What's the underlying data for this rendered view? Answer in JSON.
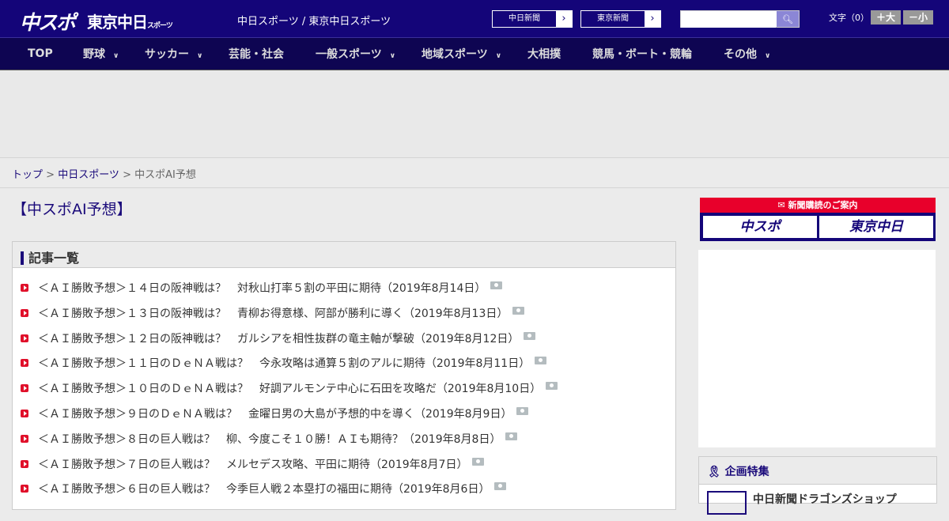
{
  "header": {
    "logo_main": "中スポ",
    "logo_tokyo": "東京中日",
    "logo_tokyo_small": "スポーツ",
    "sites": "中日スポーツ / 東京中日スポーツ",
    "paper_links": [
      "中日新聞",
      "東京新聞"
    ],
    "search_placeholder": "",
    "font_label": "文字（0）",
    "font_larger": "＋大",
    "font_smaller": "－小"
  },
  "nav": [
    {
      "label": "TOP"
    },
    {
      "label": "野球",
      "dropdown": true
    },
    {
      "label": "サッカー",
      "dropdown": true
    },
    {
      "label": "芸能・社会"
    },
    {
      "label": "一般スポーツ",
      "dropdown": true
    },
    {
      "label": "地域スポーツ",
      "dropdown": true
    },
    {
      "label": "大相撲"
    },
    {
      "label": "競馬・ボート・競輪"
    },
    {
      "label": "その他",
      "dropdown": true
    }
  ],
  "breadcrumb": {
    "home": "トップ",
    "sep": " > ",
    "section": "中日スポーツ",
    "current": "中スポAI予想"
  },
  "page_title": "【中スポAI予想】",
  "list": {
    "heading": "記事一覧",
    "items": [
      "＜ＡＩ勝敗予想＞１４日の阪神戦は？　対秋山打率５割の平田に期待（2019年8月14日）",
      "＜ＡＩ勝敗予想＞１３日の阪神戦は？　青柳お得意様、阿部が勝利に導く（2019年8月13日）",
      "＜ＡＩ勝敗予想＞１２日の阪神戦は？　ガルシアを相性抜群の竜主軸が撃破（2019年8月12日）",
      "＜ＡＩ勝敗予想＞１１日のＤｅＮＡ戦は？　今永攻略は通算５割のアルに期待（2019年8月11日）",
      "＜ＡＩ勝敗予想＞１０日のＤｅＮＡ戦は？　好調アルモンテ中心に石田を攻略だ（2019年8月10日）",
      "＜ＡＩ勝敗予想＞９日のＤｅＮＡ戦は？　金曜日男の大島が予想的中を導く（2019年8月9日）",
      "＜ＡＩ勝敗予想＞８日の巨人戦は？　柳、今度こそ１０勝！ＡＩも期待？（2019年8月8日）",
      "＜ＡＩ勝敗予想＞７日の巨人戦は？　メルセデス攻略、平田に期待（2019年8月7日）",
      "＜ＡＩ勝敗予想＞６日の巨人戦は？　今季巨人戦２本塁打の福田に期待（2019年8月6日）"
    ]
  },
  "sidebar": {
    "subscribe": "新聞購読のご案内",
    "subscribe_links": [
      "中スポ",
      "東京中日"
    ],
    "feature_heading": "企画特集",
    "feature_item": "中日新聞ドラゴンズショップ"
  },
  "colors": {
    "header": "#140579",
    "nav": "#0e0552",
    "accent": "#e0102a"
  }
}
